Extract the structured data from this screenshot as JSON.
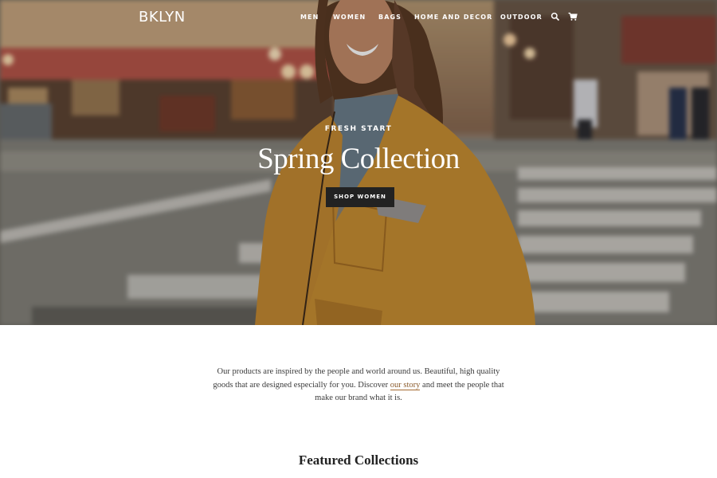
{
  "header": {
    "logo": "BKLYN",
    "nav": [
      {
        "label": "MEN"
      },
      {
        "label": "WOMEN"
      },
      {
        "label": "BAGS"
      },
      {
        "label": "HOME AND DECOR"
      },
      {
        "label": "OUTDOOR"
      }
    ],
    "icons": {
      "search": "search-icon",
      "cart": "cart-icon"
    }
  },
  "hero": {
    "eyebrow": "FRESH START",
    "title": "Spring Collection",
    "cta_label": "SHOP WOMEN"
  },
  "intro": {
    "text_before": "Our products are inspired by the people and world around us. Beautiful, high quality goods that are designed especially for you. Discover ",
    "link_text": "our story",
    "text_after": " and meet the people that make our brand what it is."
  },
  "featured": {
    "title": "Featured Collections"
  },
  "colors": {
    "cta_bg": "#222222",
    "link": "#8a5a2b",
    "jacket": "#c98f33"
  }
}
